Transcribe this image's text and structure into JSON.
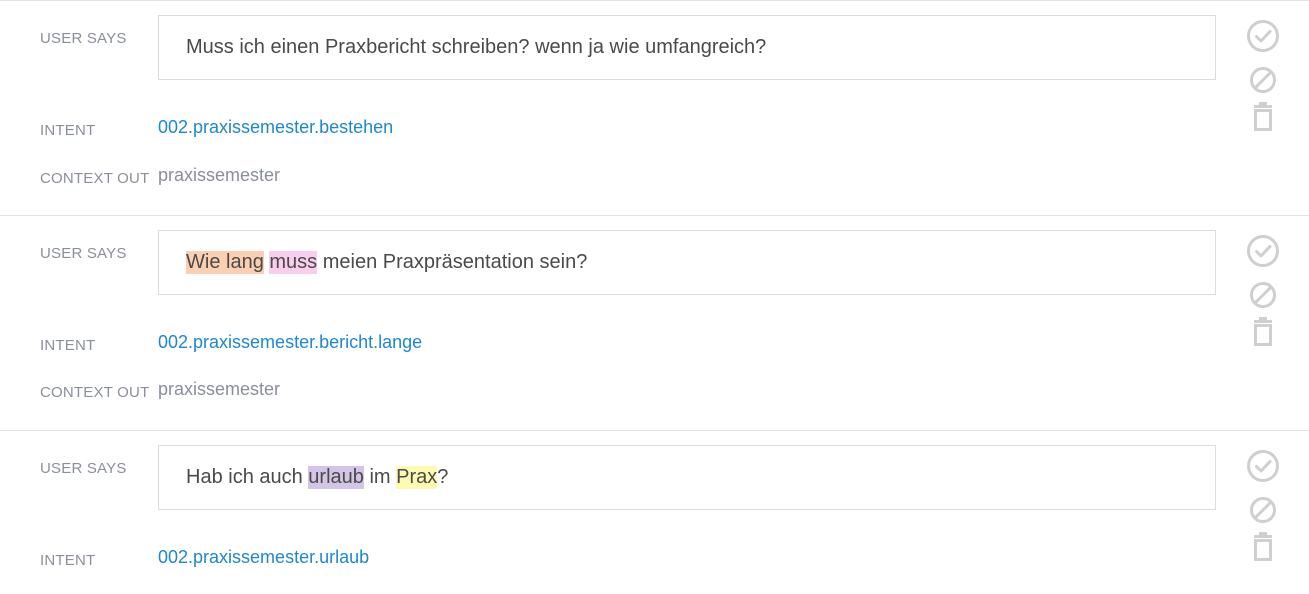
{
  "labels": {
    "user_says": "USER SAYS",
    "intent": "INTENT",
    "context_out": "CONTEXT OUT"
  },
  "colors": {
    "highlight_orange": "#fbcfb1",
    "highlight_pink": "#f9cdec",
    "highlight_purple": "#d4c4e6",
    "highlight_yellow": "#fefab1",
    "intent_link": "#1e88cf",
    "icon_gray": "#cfcfcf"
  },
  "icons": [
    "check-circle-icon",
    "block-icon",
    "trash-icon"
  ],
  "entries": [
    {
      "says_segments": [
        {
          "text": "Muss ich einen Praxbericht schreiben? wenn ja wie umfangreich?"
        }
      ],
      "intent": "002.praxissemester.bestehen",
      "context_out": "praxissemester"
    },
    {
      "says_segments": [
        {
          "text": "Wie lang",
          "highlight": "orange"
        },
        {
          "text": " "
        },
        {
          "text": "muss",
          "highlight": "pink"
        },
        {
          "text": " meien Praxpräsentation sein?"
        }
      ],
      "intent": "002.praxissemester.bericht.lange",
      "context_out": "praxissemester"
    },
    {
      "says_segments": [
        {
          "text": "Hab ich auch "
        },
        {
          "text": "urlaub",
          "highlight": "purple"
        },
        {
          "text": " im "
        },
        {
          "text": "Prax",
          "highlight": "yellow"
        },
        {
          "text": "?"
        }
      ],
      "intent": "002.praxissemester.urlaub"
    }
  ]
}
